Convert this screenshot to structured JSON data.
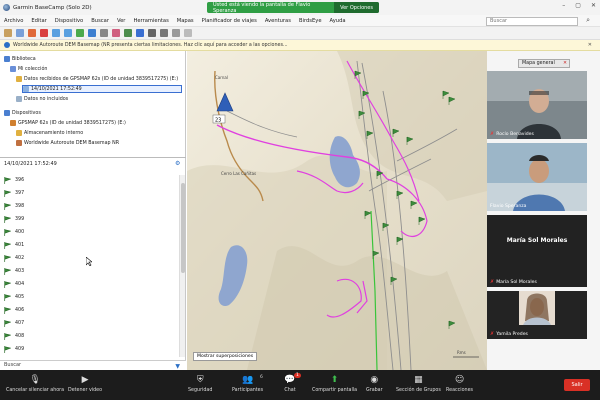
{
  "titlebar": {
    "app_title": "Garmin BaseCamp (Solo 2D)",
    "share_text": "Usted está viendo la pantalla de Flavio Speranza",
    "share_options": "Ver Opciones"
  },
  "menu": [
    "Archivo",
    "Editar",
    "Dispositivo",
    "Buscar",
    "Ver",
    "Herramientas",
    "Mapas",
    "Planificador de viajes",
    "Aventuras",
    "BirdsEye",
    "Ayuda"
  ],
  "search": {
    "placeholder": "Buscar"
  },
  "infobar": {
    "text": "Worldwide Autoroute DEM Basemap (NR presenta ciertas limitaciones. Haz clic aquí para acceder a las opciones..."
  },
  "tree": {
    "biblioteca": "Biblioteca",
    "mi_coleccion": "Mi colección",
    "datos_recibidos": "Datos recibidos de GPSMAP 62s (ID de unidad 3839517275) (E:)",
    "selected_date": "14/10/2021 17:52:49",
    "datos_no_incluidos": "Datos no incluidos",
    "dispositivos": "Dispositivos",
    "device": "GPSMAP 62s (ID de unidad 3839517275) (E:)",
    "almacenamiento": "Almacenamiento interno",
    "basemap": "Worldwide Autoroute DEM Basemap NR"
  },
  "list_header": {
    "date": "14/10/2021 17:52:49"
  },
  "waypoints": [
    "396",
    "397",
    "398",
    "399",
    "400",
    "401",
    "402",
    "403",
    "404",
    "405",
    "406",
    "407",
    "408",
    "409"
  ],
  "bottom_search": {
    "label": "Buscar"
  },
  "map": {
    "place_labels": [
      "Cerro Las Cañitas",
      "Carnal"
    ],
    "marker_number": "23",
    "overlays_button": "Mostrar superposiciones",
    "scale_label": "Rms"
  },
  "gallery": {
    "mapa_general": "Mapa general",
    "participants": [
      {
        "name": "Rocío Benavides",
        "muted": true
      },
      {
        "name": "Flavio Speranza",
        "muted": false
      },
      {
        "name": "María Sol Morales",
        "muted": true
      },
      {
        "name": "Yamila Predes",
        "muted": true
      }
    ],
    "center_name": "María Sol Morales"
  },
  "zoom_bar": {
    "items": [
      {
        "icon": "microphone-off-icon",
        "label": "Cancelar silenciar ahora"
      },
      {
        "icon": "video-off-icon",
        "label": "Detener video"
      },
      {
        "icon": "security-icon",
        "label": "Seguridad"
      },
      {
        "icon": "participants-icon",
        "label": "Participantes",
        "badge": "6"
      },
      {
        "icon": "chat-icon",
        "label": "Chat",
        "badge": "1"
      },
      {
        "icon": "share-screen-icon",
        "label": "Compartir pantalla"
      },
      {
        "icon": "record-icon",
        "label": "Grabar"
      },
      {
        "icon": "breakout-rooms-icon",
        "label": "Sección de Grupos"
      },
      {
        "icon": "reactions-icon",
        "label": "Reacciones"
      }
    ],
    "leave": "Salir"
  },
  "colors": {
    "accent_green": "#2f9e44",
    "track_magenta": "#e040e0",
    "leave_red": "#d93025",
    "zoom_dark": "#1c1c1c"
  }
}
